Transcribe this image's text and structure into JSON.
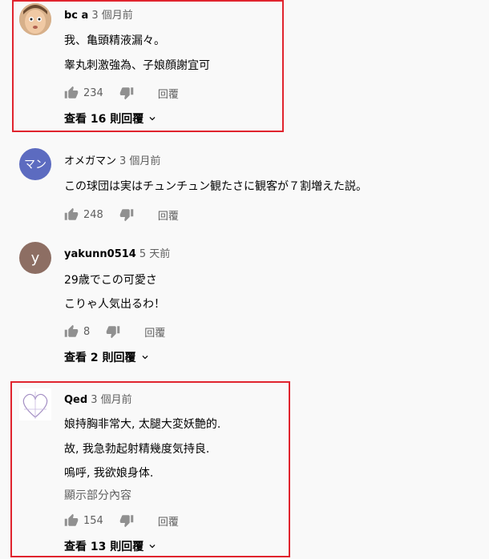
{
  "comments": [
    {
      "author": "bc a",
      "time": "3 個月前",
      "lines": [
        "我、亀頭精液漏々。",
        "睾丸刺激強為、子娘顔謝宜可"
      ],
      "likes": "234",
      "reply_label": "回覆",
      "view_replies": "查看 16 則回覆"
    },
    {
      "author": "オメガマン",
      "time": "3 個月前",
      "avatar_text": "マン",
      "avatar_color": "#5c6bc0",
      "lines": [
        "この球団は実はチュンチュン観たさに観客が７割増えた説。"
      ],
      "likes": "248",
      "reply_label": "回覆"
    },
    {
      "author": "yakunn0514",
      "time": "5 天前",
      "avatar_text": "y",
      "avatar_color": "#8d6e63",
      "lines": [
        "29歳でこの可愛さ",
        "こりゃ人気出るわ！"
      ],
      "likes": "8",
      "reply_label": "回覆",
      "view_replies": "查看 2 則回覆"
    },
    {
      "author": "Qed",
      "time": "3 個月前",
      "lines": [
        "娘持胸非常大, 太腿大変妖艶的.",
        "故, 我急勃起射精幾度気持良.",
        "嗚呼, 我欲娘身体.",
        "顯示部分內容"
      ],
      "likes": "154",
      "reply_label": "回覆",
      "view_replies": "查看 13 則回覆"
    }
  ],
  "icons": {
    "like": "thumb-up-icon",
    "dislike": "thumb-down-icon",
    "expand": "chevron-down-icon"
  },
  "colors": {
    "highlight": "#e0242e",
    "background": "#f9f9f9"
  }
}
